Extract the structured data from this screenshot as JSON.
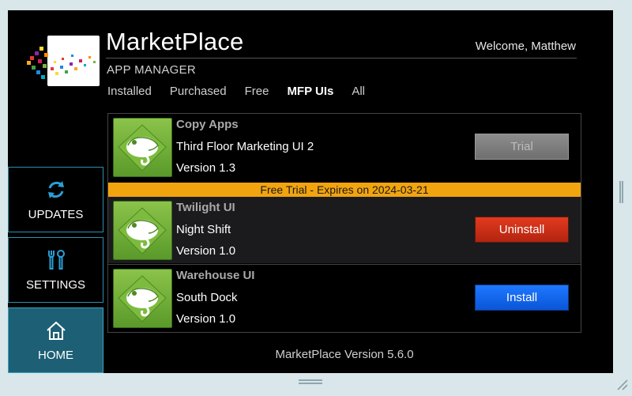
{
  "header": {
    "brand": "MarketPlace",
    "welcome": "Welcome, Matthew",
    "subtitle": "APP MANAGER"
  },
  "tabs": [
    {
      "label": "Installed",
      "active": false
    },
    {
      "label": "Purchased",
      "active": false
    },
    {
      "label": "Free",
      "active": false
    },
    {
      "label": "MFP UIs",
      "active": true
    },
    {
      "label": "All",
      "active": false
    }
  ],
  "sidebar": {
    "items": [
      {
        "label": "UPDATES",
        "icon": "refresh-icon"
      },
      {
        "label": "SETTINGS",
        "icon": "tools-icon"
      },
      {
        "label": "HOME",
        "icon": "home-icon",
        "active": true
      }
    ]
  },
  "apps": [
    {
      "name": "Copy Apps",
      "title": "Third Floor Marketing UI 2",
      "version": "Version 1.3",
      "action": "Trial",
      "icon": "chameleon-icon"
    },
    {
      "name": "Twilight UI",
      "title": "Night Shift",
      "version": "Version 1.0",
      "action": "Uninstall",
      "icon": "chameleon-icon",
      "banner": "Free Trial - Expires on 2024-03-21"
    },
    {
      "name": "Warehouse UI",
      "title": "South Dock",
      "version": "Version 1.0",
      "action": "Install",
      "icon": "chameleon-icon"
    }
  ],
  "footer": {
    "version": "MarketPlace Version 5.6.0"
  },
  "colors": {
    "trial": "#7f7f7f",
    "uninstall": "#d8321a",
    "install": "#1266ee",
    "banner": "#f2a40f",
    "sidebar_active": "#1d5f74",
    "app_icon": "#6faa33"
  }
}
